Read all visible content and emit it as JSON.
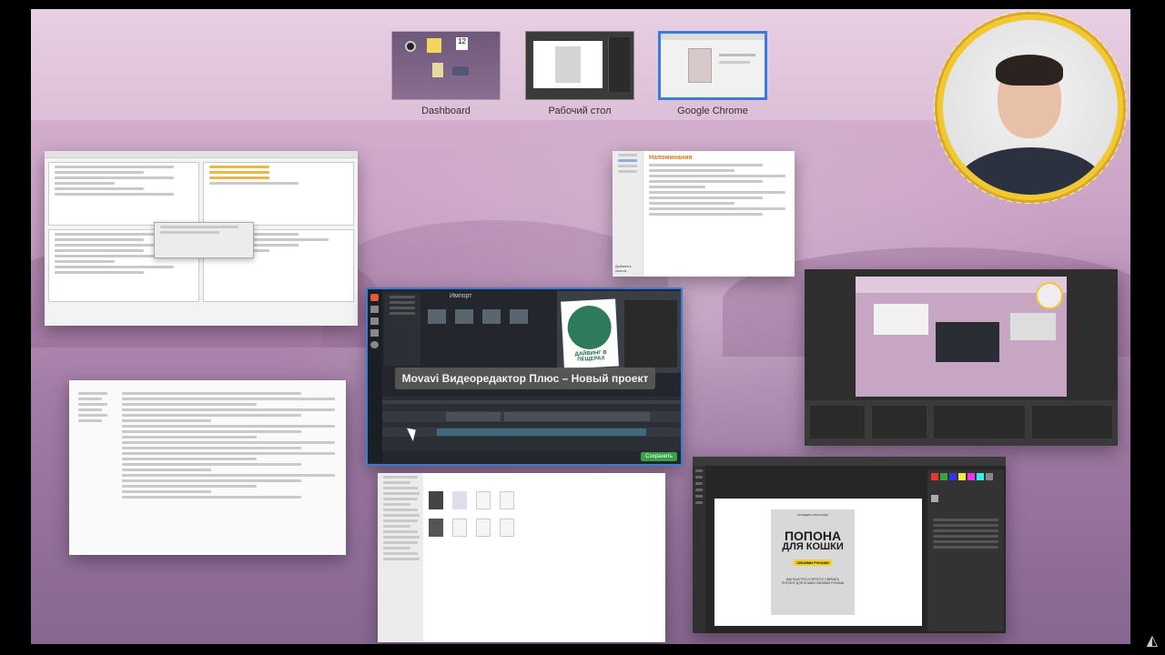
{
  "spaces": [
    {
      "label": "Dashboard",
      "active": false
    },
    {
      "label": "Рабочий стол",
      "active": false
    },
    {
      "label": "Google Chrome",
      "active": true
    }
  ],
  "movavi": {
    "title": "Movavi Видеоредактор Плюс – Новый проект",
    "import_label": "Импорт",
    "save_button": "Сохранить"
  },
  "reminder": {
    "title": "Напоминания",
    "add_label": "Добавить список"
  },
  "book": {
    "author": "ЖОНЕДИН АЛЕКСАНДР",
    "title_line1": "ПОПОНА",
    "title_line2": "ДЛЯ КОШКИ",
    "highlight": "СВОИМИ РУКАМИ",
    "subtitle": "КАК БЫСТРО И ПРОСТО СВЯЗАТЬ ПОПОНУ ДЛЯ КОШКИ СВОИМИ РУКАМИ"
  },
  "diving_book": {
    "title": "ДАЙВИНГ В ПЕЩЕРАХ"
  },
  "colors": {
    "active_border": "#3d7bd8",
    "webcam_ring": "#f2c830",
    "save_green": "#3aa04a",
    "book_highlight": "#f2d12e"
  },
  "icons": {
    "watermark": "academy-logo-icon",
    "cursor": "arrow-cursor-icon"
  }
}
